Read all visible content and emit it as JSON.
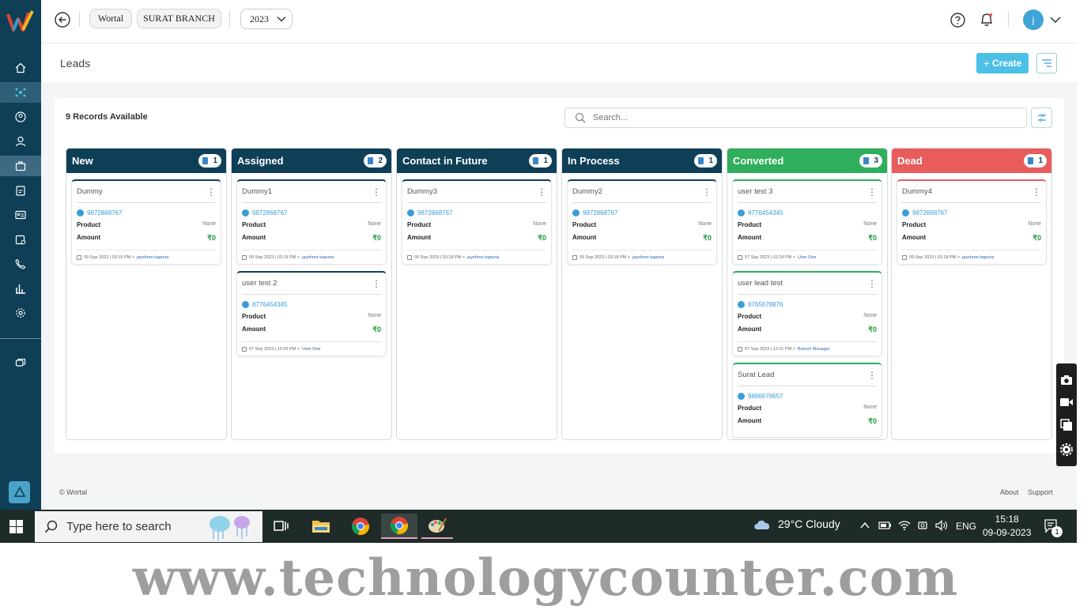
{
  "topbar": {
    "org": "Wortal",
    "branch": "SURAT BRANCH",
    "year": "2023",
    "avatar_initial": "j"
  },
  "page": {
    "title": "Leads",
    "create_label": "Create"
  },
  "board": {
    "records": "9 Records Available",
    "search_placeholder": "Search...",
    "columns": [
      {
        "title": "New",
        "count": "1",
        "color": "#0e3f57",
        "cards": [
          {
            "name": "Dummy",
            "phone": "9872868767",
            "product_label": "Product",
            "product": "None",
            "amount_label": "Amount",
            "amount": "₹0",
            "date": "09 Sep 2023 | 03:15 PM >",
            "user": "jayshree kapuria"
          }
        ]
      },
      {
        "title": "Assigned",
        "count": "2",
        "color": "#0e3f57",
        "cards": [
          {
            "name": "Dummy1",
            "phone": "9872868767",
            "product_label": "Product",
            "product": "None",
            "amount_label": "Amount",
            "amount": "₹0",
            "date": "09 Sep 2023 | 03:15 PM >",
            "user": "jayshree kapuria"
          },
          {
            "name": "user test 2",
            "phone": "8776454345",
            "product_label": "Product",
            "product": "None",
            "amount_label": "Amount",
            "amount": "₹0",
            "date": "07 Sep 2023 | 12:43 PM >",
            "user": "User One"
          }
        ]
      },
      {
        "title": "Contact in Future",
        "count": "1",
        "color": "#0e3f57",
        "cards": [
          {
            "name": "Dummy3",
            "phone": "9872868767",
            "product_label": "Product",
            "product": "None",
            "amount_label": "Amount",
            "amount": "₹0",
            "date": "09 Sep 2023 | 03:18 PM >",
            "user": "jayshree kapuria"
          }
        ]
      },
      {
        "title": "In Process",
        "count": "1",
        "color": "#0e3f57",
        "cards": [
          {
            "name": "Dummy2",
            "phone": "9872868767",
            "product_label": "Product",
            "product": "None",
            "amount_label": "Amount",
            "amount": "₹0",
            "date": "09 Sep 2023 | 03:18 PM >",
            "user": "jayshree kapuria"
          }
        ]
      },
      {
        "title": "Converted",
        "count": "3",
        "color": "#2fae5b",
        "cards": [
          {
            "name": "user test 3",
            "phone": "8776454345",
            "product_label": "Product",
            "product": "None",
            "amount_label": "Amount",
            "amount": "₹0",
            "date": "07 Sep 2023 | 02:24 PM >",
            "user": "User One"
          },
          {
            "name": "user lead test",
            "phone": "8765678876",
            "product_label": "Product",
            "product": "None",
            "amount_label": "Amount",
            "amount": "₹0",
            "date": "07 Sep 2023 | 12:01 PM >",
            "user": "Branch Manager"
          },
          {
            "name": "Surat Lead",
            "phone": "9886678657",
            "product_label": "Product",
            "product": "None",
            "amount_label": "Amount",
            "amount": "₹0",
            "date": "",
            "user": ""
          }
        ]
      },
      {
        "title": "Dead",
        "count": "1",
        "color": "#e85c5c",
        "cards": [
          {
            "name": "Dummy4",
            "phone": "9872868767",
            "product_label": "Product",
            "product": "None",
            "amount_label": "Amount",
            "amount": "₹0",
            "date": "09 Sep 2023 | 03:18 PM >",
            "user": "jayshree kapuria"
          }
        ]
      }
    ]
  },
  "footer": {
    "copyright": "© Wortal",
    "about": "About",
    "support": "Support"
  },
  "taskbar": {
    "search_placeholder": "Type here to search",
    "weather": "29°C  Cloudy",
    "lang": "ENG",
    "time": "15:18",
    "date": "09-09-2023",
    "notif_count": "1"
  },
  "watermark": "www.technologycounter.com",
  "icons": {
    "back": "arrow-left-circle-icon",
    "help": "question-circle-icon",
    "bell": "bell-icon",
    "chevron": "chevron-down-icon"
  },
  "colors": {
    "sidebar": "#0e3f57",
    "accent": "#4cc0e6",
    "converted": "#2fae5b",
    "dead": "#e85c5c"
  }
}
